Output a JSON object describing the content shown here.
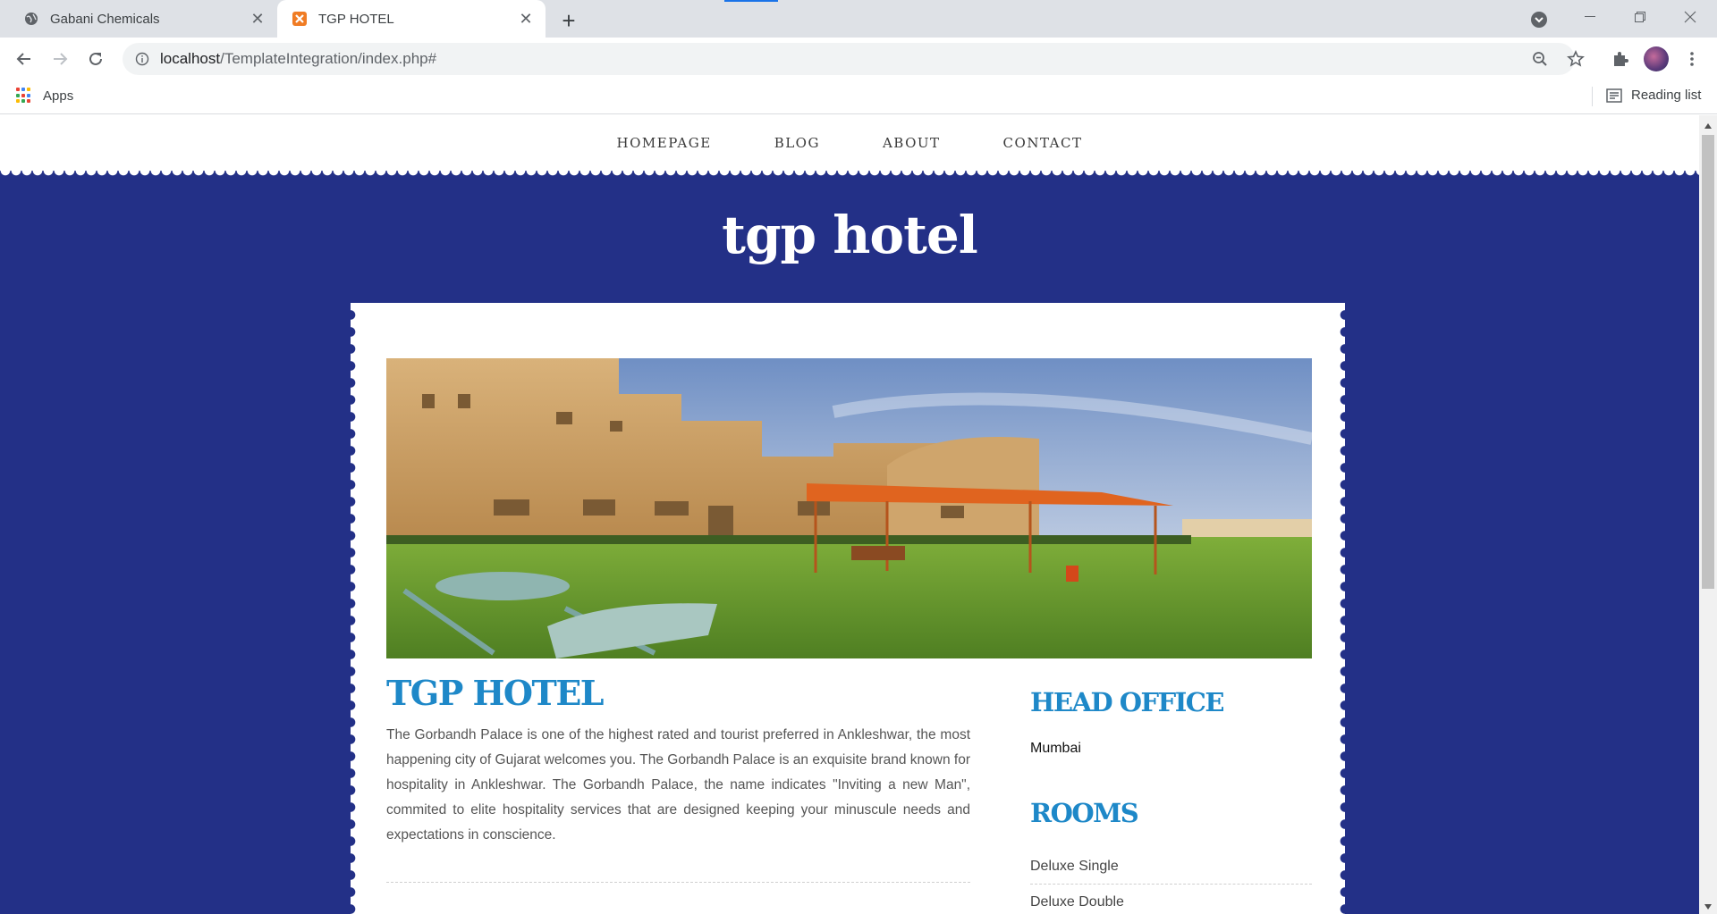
{
  "browser": {
    "tabs": [
      {
        "title": "Gabani Chemicals",
        "active": false
      },
      {
        "title": "TGP HOTEL",
        "active": true
      }
    ],
    "url_host": "localhost",
    "url_path": "/TemplateIntegration/index.php#",
    "bookmarks": {
      "apps_label": "Apps",
      "reading_list_label": "Reading list"
    }
  },
  "site": {
    "nav": [
      "HOMEPAGE",
      "BLOG",
      "ABOUT",
      "CONTACT"
    ],
    "title": "tgp hotel",
    "colors": {
      "background": "#233087",
      "accent": "#1e88c8"
    }
  },
  "main": {
    "heading": "TGP HOTEL",
    "paragraph": "The Gorbandh Palace is one of the highest rated and tourist preferred in Ankleshwar, the most happening city of Gujarat welcomes you. The Gorbandh Palace is an exquisite brand known for hospitality in Ankleshwar. The Gorbandh Palace, the name indicates \"Inviting a new Man\", commited to elite hospitality services that are designed keeping your minuscule needs and expectations in conscience."
  },
  "sidebar": {
    "head_office_heading": "HEAD OFFICE",
    "head_office_city": "Mumbai",
    "rooms_heading": "ROOMS",
    "rooms": [
      "Deluxe Single",
      "Deluxe Double"
    ]
  }
}
